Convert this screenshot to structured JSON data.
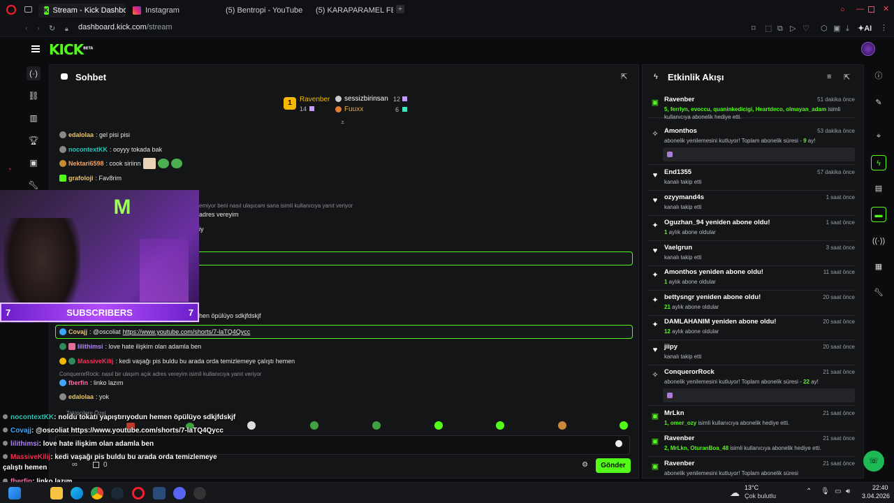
{
  "tabs": [
    {
      "label": "Stream - Kick Dashboard",
      "active": true
    },
    {
      "label": "Instagram"
    },
    {
      "label": "(5) Bentropi - YouTube"
    },
    {
      "label": "(5) KARAPARAMEL FETTO"
    }
  ],
  "address": {
    "domain": "dashboard.kick.com",
    "path": "/stream"
  },
  "toolbar": {
    "ai_label": "AI"
  },
  "logo": {
    "text": "KICK",
    "beta": "BETA"
  },
  "chat": {
    "title": "Sohbet",
    "leaderboard": {
      "first": {
        "name": "Ravenber",
        "count": "14",
        "rank": "1"
      },
      "second": {
        "name": "sessizbirinsan",
        "count": "12"
      },
      "third": {
        "name": "Fuuxx",
        "count": "6"
      }
    },
    "messages": [
      {
        "user": "edalolaa",
        "text": ": gel pisi pisi",
        "color": "#e9c46a"
      },
      {
        "user": "nocontextKK",
        "text": ": ooyyy tokada bak",
        "color": "#2ec4b6"
      },
      {
        "user": "Nektari6598",
        "text": ": cook siriinn",
        "color": "#f4a261"
      },
      {
        "user": "grafoloji",
        "text": ": Fav8rim",
        "color": "#e9c46a"
      }
    ],
    "partial_reply": "emiyor beni nasıl ulaşıcam sana isimli kullanıcıya yanıt veriyor",
    "partial1": "adres vereyim",
    "partial2": "iy",
    "partial3": "hen öpülüyo sdkjfdskjf",
    "pinned": {
      "user": "Covajj",
      "text": ": @oscoliat ",
      "link": "https://www.youtube.com/shorts/7-laTQ4Qycc"
    },
    "msg_lilithimsi": {
      "user": "lilithimsi",
      "text": ": love hate ilişkim olan adamla ben"
    },
    "msg_massive": {
      "user": "MassiveKilij",
      "text": ": kedi vaşağı pis buldu bu arada orda temizlemeye çalıştı hemen"
    },
    "reply_line": "ConquerorRock: nasıl bir ulaşım açık adres vereyim isimli kullanıcıya yanıt veriyor",
    "msg_fberfin": {
      "user": "fberfin",
      "text": ": linko lazım"
    },
    "msg_edalolaa2": {
      "user": "edalolaa",
      "text": ": yok"
    },
    "followers_only": "Takipçilere Özel",
    "input_zero": "0",
    "send_label": "Gönder"
  },
  "activity": {
    "title": "Etkinlik Akışı",
    "items": [
      {
        "icon": "gift-icon",
        "title": "Ravenber",
        "time": "51 dakika önce",
        "sub_pre": "",
        "sub_green": "5, ferrlyn, evoccu, quaninkedicigi, Heartdeco, olmayan_adam",
        "sub_post": " isimli kullanıcıya abonelik hediye etti."
      },
      {
        "icon": "resub-icon",
        "title": "Amonthos",
        "time": "53 dakika önce",
        "sub_pre": "abonelik yenilemesini kutluyor! Toplam abonelik süresi - ",
        "sub_green": "9",
        "sub_post": " ay!"
      },
      {
        "icon": "heart-icon",
        "title": "End1355",
        "time": "57 dakika önce",
        "sub_pre": "kanalı takip etti",
        "sub_green": "",
        "sub_post": ""
      },
      {
        "icon": "heart-icon",
        "title": "ozyymand4s",
        "time": "1 saat önce",
        "sub_pre": "kanalı takip etti",
        "sub_green": "",
        "sub_post": ""
      },
      {
        "icon": "star-icon",
        "title": "Oguzhan_94 yeniden abone oldu!",
        "time": "1 saat önce",
        "sub_pre": "",
        "sub_green": "1",
        "sub_post": " aylık abone oldular"
      },
      {
        "icon": "heart-icon",
        "title": "Vaelgrun",
        "time": "3 saat önce",
        "sub_pre": "kanalı takip etti",
        "sub_green": "",
        "sub_post": ""
      },
      {
        "icon": "star-icon",
        "title": "Amonthos yeniden abone oldu!",
        "time": "11 saat önce",
        "sub_pre": "",
        "sub_green": "1",
        "sub_post": " aylık abone oldular"
      },
      {
        "icon": "star-icon",
        "title": "bettysngr yeniden abone oldu!",
        "time": "20 saat önce",
        "sub_pre": "",
        "sub_green": "21",
        "sub_post": " aylık abone oldular"
      },
      {
        "icon": "star-icon",
        "title": "DAMLAHANIM yeniden abone oldu!",
        "time": "20 saat önce",
        "sub_pre": "",
        "sub_green": "12",
        "sub_post": " aylık abone oldular"
      },
      {
        "icon": "heart-icon",
        "title": "jiipy",
        "time": "20 saat önce",
        "sub_pre": "kanalı takip etti",
        "sub_green": "",
        "sub_post": ""
      },
      {
        "icon": "resub-icon",
        "title": "ConquerorRock",
        "time": "21 saat önce",
        "sub_pre": "abonelik yenilemesini kutluyor! Toplam abonelik süresi - ",
        "sub_green": "22",
        "sub_post": " ay!"
      },
      {
        "icon": "gift-icon",
        "title": "MrLkn",
        "time": "21 saat önce",
        "sub_pre": "",
        "sub_green": "1, omer_ozy",
        "sub_post": " isimli kullanıcıya abonelik hediye etti."
      },
      {
        "icon": "gift-icon",
        "title": "Ravenber",
        "time": "21 saat önce",
        "sub_pre": "",
        "sub_green": "2, MrLkn, OturanBoa_48",
        "sub_post": " isimli kullanıcıya abonelik hediye etti."
      },
      {
        "icon": "gift-icon",
        "title": "Ravenber",
        "time": "21 saat önce",
        "sub_pre": "abonelik yenilemesini kutluyor! Toplam abonelik süresi",
        "sub_green": "",
        "sub_post": ""
      }
    ]
  },
  "overlay": {
    "subs_count": "7",
    "subs_label": "SUBSCRIBERS",
    "chat": [
      {
        "user": "nocontextKK",
        "text": ": noldu tokatı yapıştırıyodun hemen öpülüyo sdkjfdskjf",
        "color": "#2ec4b6"
      },
      {
        "user": "Covajj",
        "text": ": @oscoliat https://www.youtube.com/shorts/7-laTQ4Qycc",
        "color": "#3fa7ff"
      },
      {
        "user": "lilithimsi",
        "text": ": love hate ilişkim olan adamla ben",
        "color": "#b084f5"
      },
      {
        "user": "MassiveKilij",
        "text": ": kedi vaşağı pis buldu bu arada orda temizlemeye",
        "color": "#ff2d55"
      },
      {
        "user": "",
        "text": "çalıştı hemen",
        "color": "#ffffff"
      },
      {
        "user": "fberfin",
        "text": ": linko lazım",
        "color": "#ff6ba6"
      },
      {
        "user": "edalolaa",
        "text": ": yok",
        "color": "#e9c46a"
      }
    ]
  },
  "taskbar": {
    "temp": "13°C",
    "weather": "Çok bulutlu",
    "time": "22:40",
    "date": "3.04.2026"
  },
  "colors": {
    "accent": "#53fc18",
    "bg": "#0b0c0e",
    "panel": "#141517"
  }
}
